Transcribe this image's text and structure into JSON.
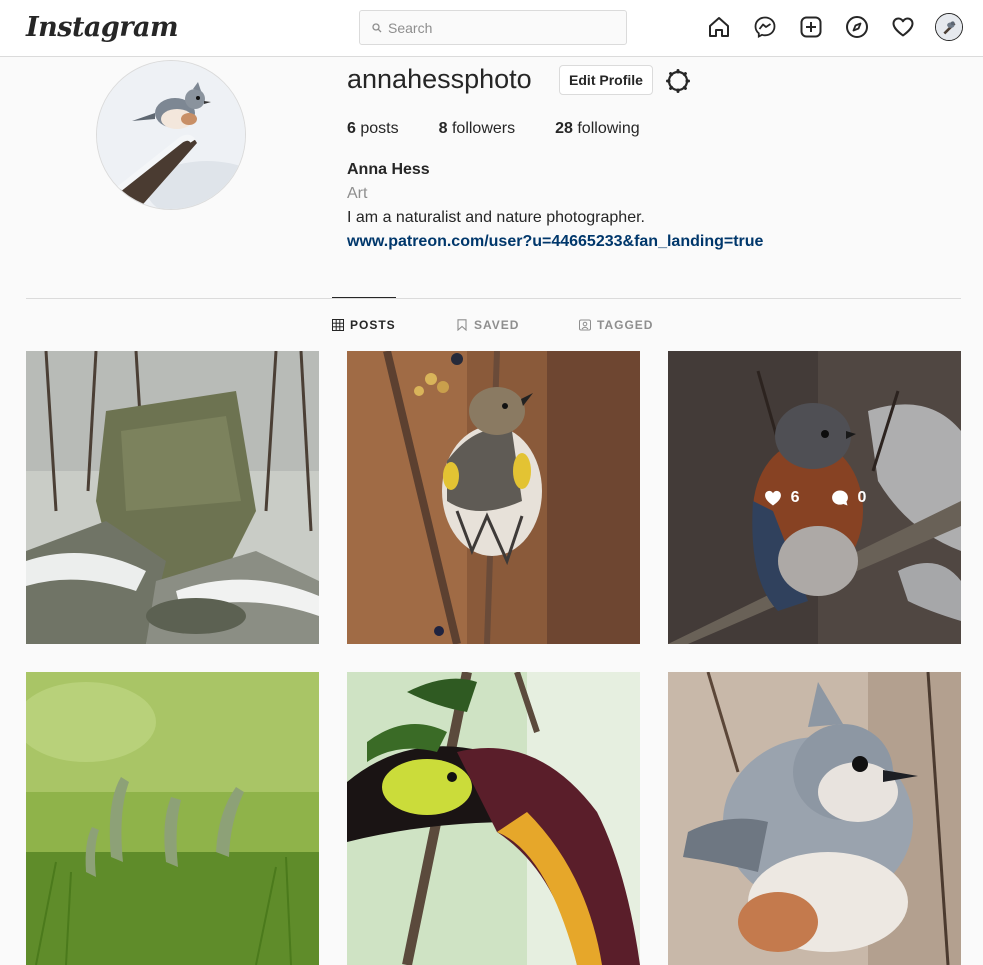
{
  "header": {
    "logo": "Instagram",
    "search_placeholder": "Search"
  },
  "nav": {
    "icons": [
      "home-icon",
      "messenger-icon",
      "new-post-icon",
      "explore-icon",
      "activity-heart-icon"
    ]
  },
  "profile": {
    "username": "annahessphoto",
    "edit_label": "Edit Profile",
    "stats": {
      "posts_count": "6",
      "posts_label": "posts",
      "followers_count": "8",
      "followers_label": "followers",
      "following_count": "28",
      "following_label": "following"
    },
    "full_name": "Anna Hess",
    "category": "Art",
    "bio": "I am a naturalist and nature photographer.",
    "link": "www.patreon.com/user?u=44665233&fan_landing=true"
  },
  "tabs": {
    "posts": "POSTS",
    "saved": "SAVED",
    "tagged": "TAGGED"
  },
  "hover_overlay": {
    "likes": "6",
    "comments": "0"
  }
}
